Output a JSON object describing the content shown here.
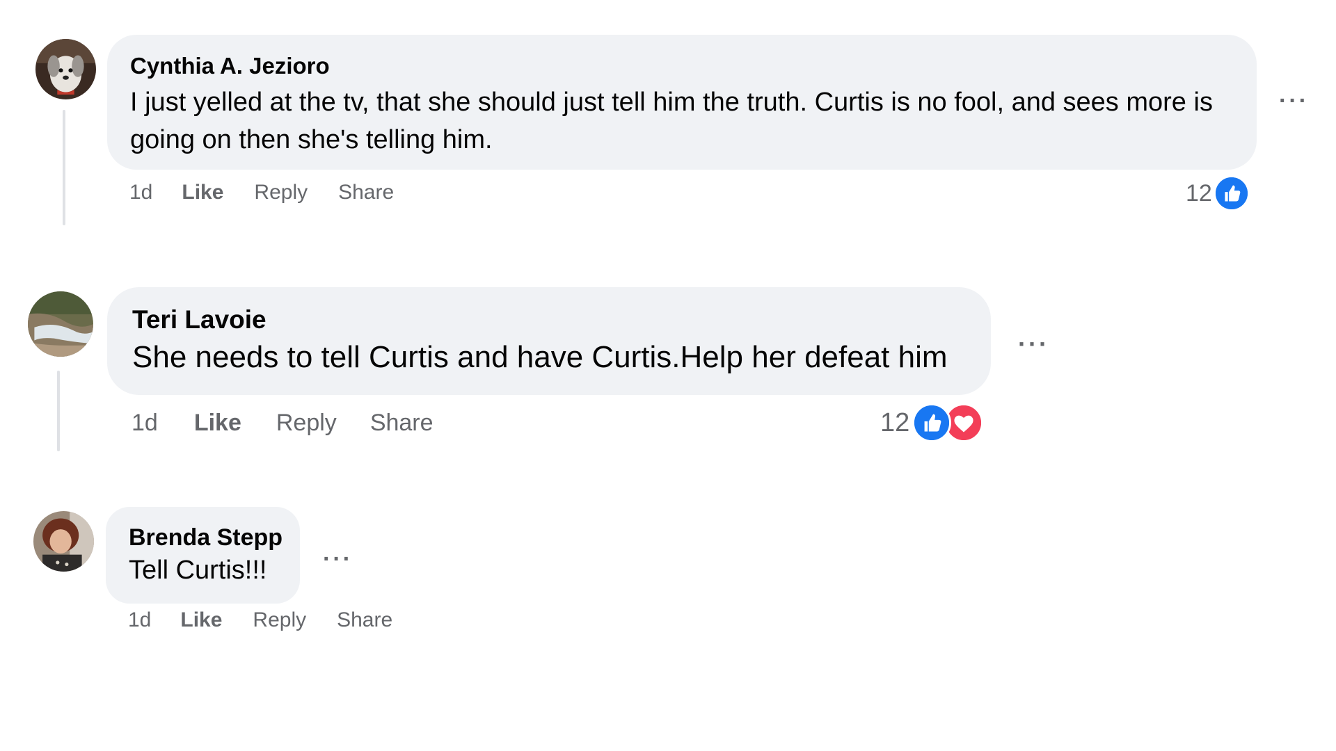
{
  "comments": [
    {
      "author": "Cynthia A. Jezioro",
      "text": "I just yelled at the tv, that she should just tell him the truth. Curtis is no fool, and sees more is going on then she's telling him.",
      "time": "1d",
      "like_label": "Like",
      "reply_label": "Reply",
      "share_label": "Share",
      "reaction_count": "12",
      "reactions": [
        "like-icon"
      ],
      "more_label": "···"
    },
    {
      "author": "Teri Lavoie",
      "text": "She needs to tell Curtis and have Curtis.Help her defeat him",
      "time": "1d",
      "like_label": "Like",
      "reply_label": "Reply",
      "share_label": "Share",
      "reaction_count": "12",
      "reactions": [
        "like-icon",
        "love-icon"
      ],
      "more_label": "···"
    },
    {
      "author": "Brenda Stepp",
      "text": "Tell Curtis!!!",
      "time": "1d",
      "like_label": "Like",
      "reply_label": "Reply",
      "share_label": "Share",
      "more_label": "···"
    }
  ],
  "colors": {
    "bubble": "#f0f2f5",
    "action_text": "#65676b",
    "like_blue": "#1877f2",
    "love_red": "#f33e58"
  }
}
